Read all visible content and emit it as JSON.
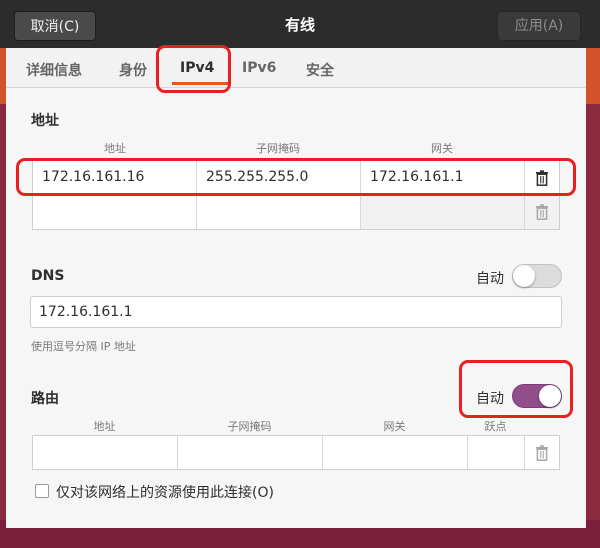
{
  "window": {
    "title": "有线",
    "cancel_label": "取消(C)",
    "apply_label": "应用(A)"
  },
  "tabs": [
    {
      "label": "详细信息",
      "active": false
    },
    {
      "label": "身份",
      "active": false
    },
    {
      "label": "IPv4",
      "active": true
    },
    {
      "label": "IPv6",
      "active": false
    },
    {
      "label": "安全",
      "active": false
    }
  ],
  "address": {
    "title": "地址",
    "columns": [
      "地址",
      "子网掩码",
      "网关"
    ],
    "rows": [
      {
        "address": "172.16.161.16",
        "netmask": "255.255.255.0",
        "gateway": "172.16.161.1"
      },
      {
        "address": "",
        "netmask": "",
        "gateway": ""
      }
    ]
  },
  "dns": {
    "title": "DNS",
    "auto_label": "自动",
    "auto_on": false,
    "value": "172.16.161.1",
    "hint": "使用逗号分隔 IP 地址"
  },
  "routes": {
    "title": "路由",
    "auto_label": "自动",
    "auto_on": true,
    "columns": [
      "地址",
      "子网掩码",
      "网关",
      "跃点"
    ]
  },
  "only_resources_checkbox": {
    "label": "仅对该网络上的资源使用此连接(O)",
    "checked": false
  },
  "icons": [
    "trash-icon"
  ],
  "colors": {
    "accent": "#e95420",
    "switch_on": "#924d8b",
    "highlight": "#e8201f"
  }
}
